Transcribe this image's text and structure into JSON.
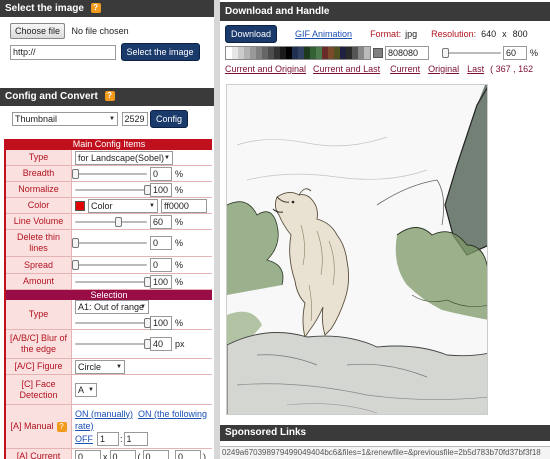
{
  "left": {
    "select_image": {
      "title": "Select the image",
      "help": "?",
      "choose_file": "Choose file",
      "no_file": "No file chosen",
      "url_value": "http://",
      "select_button": "Select the image"
    },
    "config": {
      "title": "Config and Convert",
      "help": "?",
      "preset": "Thumbnail",
      "size_value": "2529",
      "config_button": "Config"
    },
    "main_items": {
      "title": "Main Config Items",
      "type_label": "Type",
      "type_value": "for Landscape(Sobel)",
      "breadth_label": "Breadth",
      "breadth_value": "0",
      "breadth_level": 0,
      "normalize_label": "Normalize",
      "normalize_value": "100",
      "normalize_level": 1,
      "color_label": "Color",
      "color_select": "Color",
      "color_hex": "ff0000",
      "swatch_color": "#e00000",
      "line_volume_label": "Line Volume",
      "line_volume_value": "60",
      "line_volume_level": 0.6,
      "delete_thin_label": "Delete thin lines",
      "delete_thin_value": "0",
      "delete_thin_level": 0,
      "spread_label": "Spread",
      "spread_value": "0",
      "spread_level": 0,
      "amount_label": "Amount",
      "amount_value": "100",
      "amount_level": 1,
      "pct": "%"
    },
    "selection": {
      "title": "Selection",
      "type_label": "Type",
      "type_value": "A1: Out of range",
      "type_slider_value": "100",
      "type_level": 1,
      "blur_label": "[A/B/C] Blur of the edge",
      "blur_value": "40",
      "blur_level": 1,
      "px": "px",
      "figure_label": "[A/C] Figure",
      "figure_value": "Circle",
      "face_label": "[C] Face Detection",
      "face_value": "A",
      "manual_label": "[A] Manual",
      "manual_on": "ON (manually)",
      "manual_on_rate": "ON (the following rate)",
      "manual_off": "OFF",
      "manual_x": "1",
      "manual_y": "1",
      "current_label": "[A] Current",
      "current_a": "0",
      "current_b": "0",
      "current_c": "0",
      "current_d": "0",
      "x": "x",
      "colon": ":",
      "paren_open": "(",
      "comma": ",",
      "paren_close": ")",
      "percent": "%"
    }
  },
  "right": {
    "title": "Download and Handle",
    "download_button": "Download",
    "gif_link": "GIF Animation",
    "format_label": "Format:",
    "format_value": "jpg",
    "resolution_label": "Resolution:",
    "resolution_w": "640",
    "resolution_x": "x",
    "resolution_h": "800",
    "bg_hex": "808080",
    "zoom_value": "60",
    "zoom_unit": "%",
    "palette": [
      "#ffffff",
      "#e6e6e6",
      "#cccccc",
      "#b3b3b3",
      "#999999",
      "#808080",
      "#666666",
      "#4d4d4d",
      "#333333",
      "#1a1a1a",
      "#000000",
      "#203050",
      "#304060",
      "#1d3a1d",
      "#355f35",
      "#4d7a4d",
      "#6a2a2a",
      "#7a4a2a",
      "#505020",
      "#202040",
      "#2a2a2a",
      "#555555",
      "#888888",
      "#bbbbbb"
    ],
    "links": {
      "current_and_original": "Current and Original",
      "current_and_last": "Current and Last",
      "current": "Current",
      "original": "Original",
      "last": "Last",
      "coords": "( 367 , 162"
    },
    "sponsored": "Sponsored Links",
    "status_url": "0249a670398979499049404bc6&files=1&renewfile=&previousfile=2b5d783b70fd37bf3f18"
  }
}
